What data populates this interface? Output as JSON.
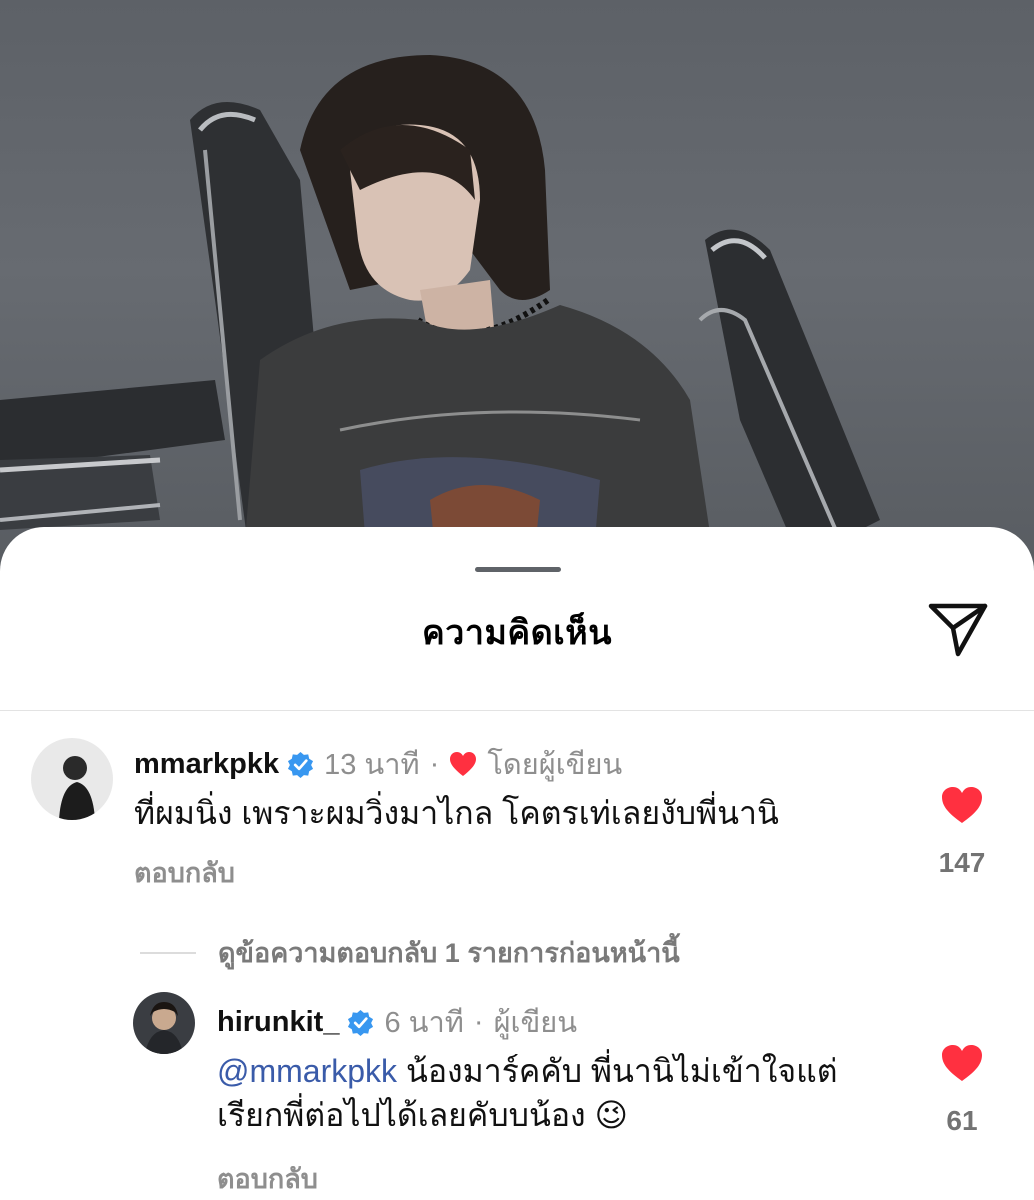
{
  "sheet": {
    "title": "ความคิดเห็น"
  },
  "icons": {
    "share": "send-paper-plane-icon",
    "verified": "verified-badge-icon",
    "like": "heart-icon"
  },
  "colors": {
    "like_red": "#ff3040",
    "verified_blue": "#3897f0",
    "mention_blue": "#3a5ba9",
    "muted": "#8e8e8e"
  },
  "comments": [
    {
      "username": "mmarkpkk",
      "verified": true,
      "time": "13 นาที",
      "separator": "·",
      "author_badge": "โดยผู้เขียน",
      "text": "ที่ผมนิ่ง เพราะผมวิ่งมาไกล โคตรเท่เลยงับพี่นานิ",
      "reply_label": "ตอบกลับ",
      "likes": "147",
      "liked": true
    },
    {
      "username": "hirunkit_",
      "verified": true,
      "time": "6 นาที",
      "separator": "·",
      "author_badge": "ผู้เขียน",
      "mention": "@mmarkpkk",
      "text_line1": "น้องมาร์คคับ พี่นานิไม่เข้าใจแต่",
      "text_line2": "เรียกพี่ต่อไปได้เลยคับบน้อง 😉",
      "reply_label": "ตอบกลับ",
      "likes": "61",
      "liked": true
    }
  ],
  "view_replies": "ดูข้อความตอบกลับ 1 รายการก่อนหน้านี้"
}
